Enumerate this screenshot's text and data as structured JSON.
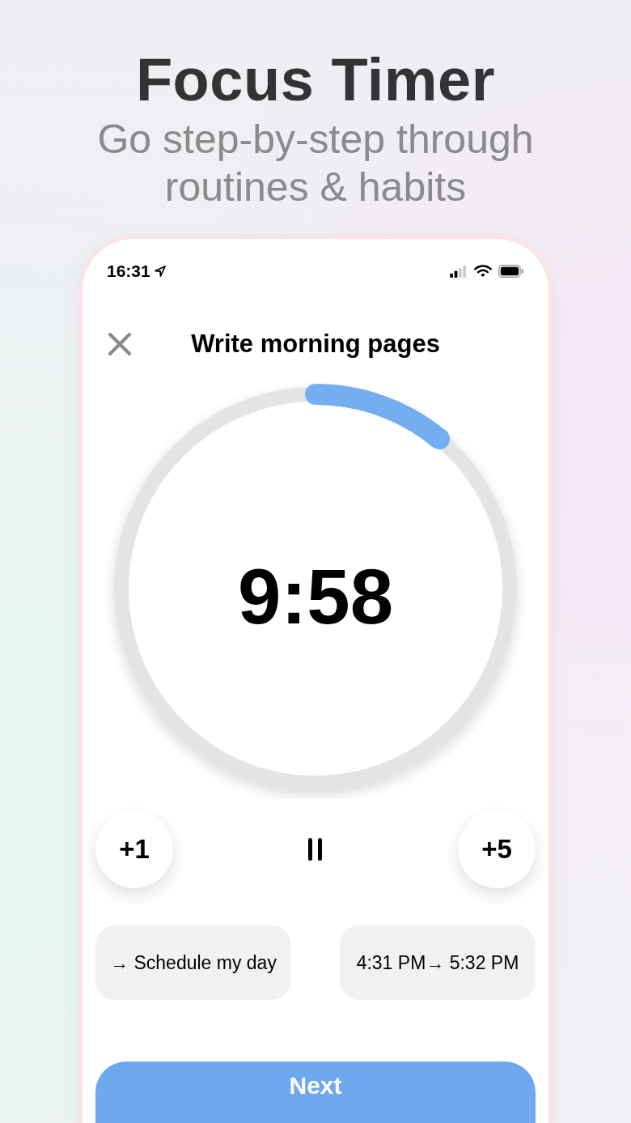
{
  "headline": "Focus Timer",
  "subtitle": "Go step-by-step through routines & habits",
  "status_bar": {
    "time": "16:31"
  },
  "task": {
    "title": "Write morning pages"
  },
  "timer": {
    "remaining": "9:58",
    "level": 0.11
  },
  "controls": [
    {
      "kind": "add",
      "label": "+1"
    },
    {
      "kind": "pause"
    },
    {
      "kind": "add",
      "label": "+5"
    }
  ],
  "chips": [
    {
      "label": "→ Schedule my day"
    },
    {
      "label": "4:31 PM→ 5:32 PM"
    }
  ],
  "next_button": {
    "label": "Next"
  }
}
